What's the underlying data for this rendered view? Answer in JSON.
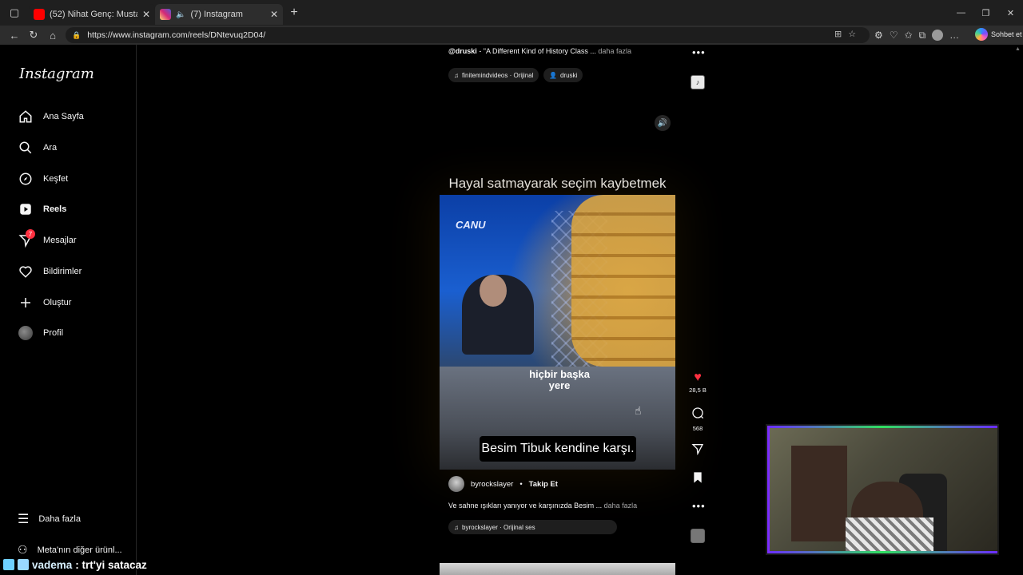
{
  "browser": {
    "tabs": [
      {
        "title": "(52) Nihat Genç: Mustafa Kemal l...",
        "favicon_color": "#ff0000",
        "active": false
      },
      {
        "title": "(7) Instagram",
        "favicon_color": "#d6249f",
        "active": true
      }
    ],
    "url": "https://www.instagram.com/reels/DNtevuq2D04/",
    "copilot_label": "Sohbet et"
  },
  "sidebar": {
    "logo": "Instagram",
    "items": [
      {
        "label": "Ana Sayfa",
        "icon": "home-icon"
      },
      {
        "label": "Ara",
        "icon": "search-icon"
      },
      {
        "label": "Keşfet",
        "icon": "compass-icon"
      },
      {
        "label": "Reels",
        "icon": "reels-icon"
      },
      {
        "label": "Mesajlar",
        "icon": "messenger-icon",
        "badge": "7"
      },
      {
        "label": "Bildirimler",
        "icon": "heart-icon"
      },
      {
        "label": "Oluştur",
        "icon": "plus-icon"
      },
      {
        "label": "Profil",
        "icon": "profile-avatar"
      }
    ],
    "more": "Daha fazla",
    "meta": "Meta'nın diğer ürünl..."
  },
  "previous_reel": {
    "username": "@druski",
    "caption": "- \"A Different Kind of History Class ...",
    "more": "daha fazla",
    "audio": "finitemindvideos · Orijinal",
    "tagged": "druski"
  },
  "reel": {
    "title": "Hayal satmayarak seçim kaybetmek",
    "subtitle1": "hiçbir başka yere",
    "subtitle2": "Besim Tibuk kendine karşı.",
    "channel_logo": "CANU",
    "likes": "28,5 B",
    "comments": "568",
    "username": "byrockslayer",
    "follow": "Takip Et",
    "caption": "Ve sahne ışıkları yanıyor ve karşınızda Besim ...",
    "more": "daha fazla",
    "audio": "byrockslayer · Orijinal ses"
  },
  "chat": {
    "user": "vadema",
    "message": ": trt'yi satacaz"
  },
  "colors": {
    "like_red": "#ff3040",
    "badge_red": "#ff3040",
    "background": "#000000"
  }
}
